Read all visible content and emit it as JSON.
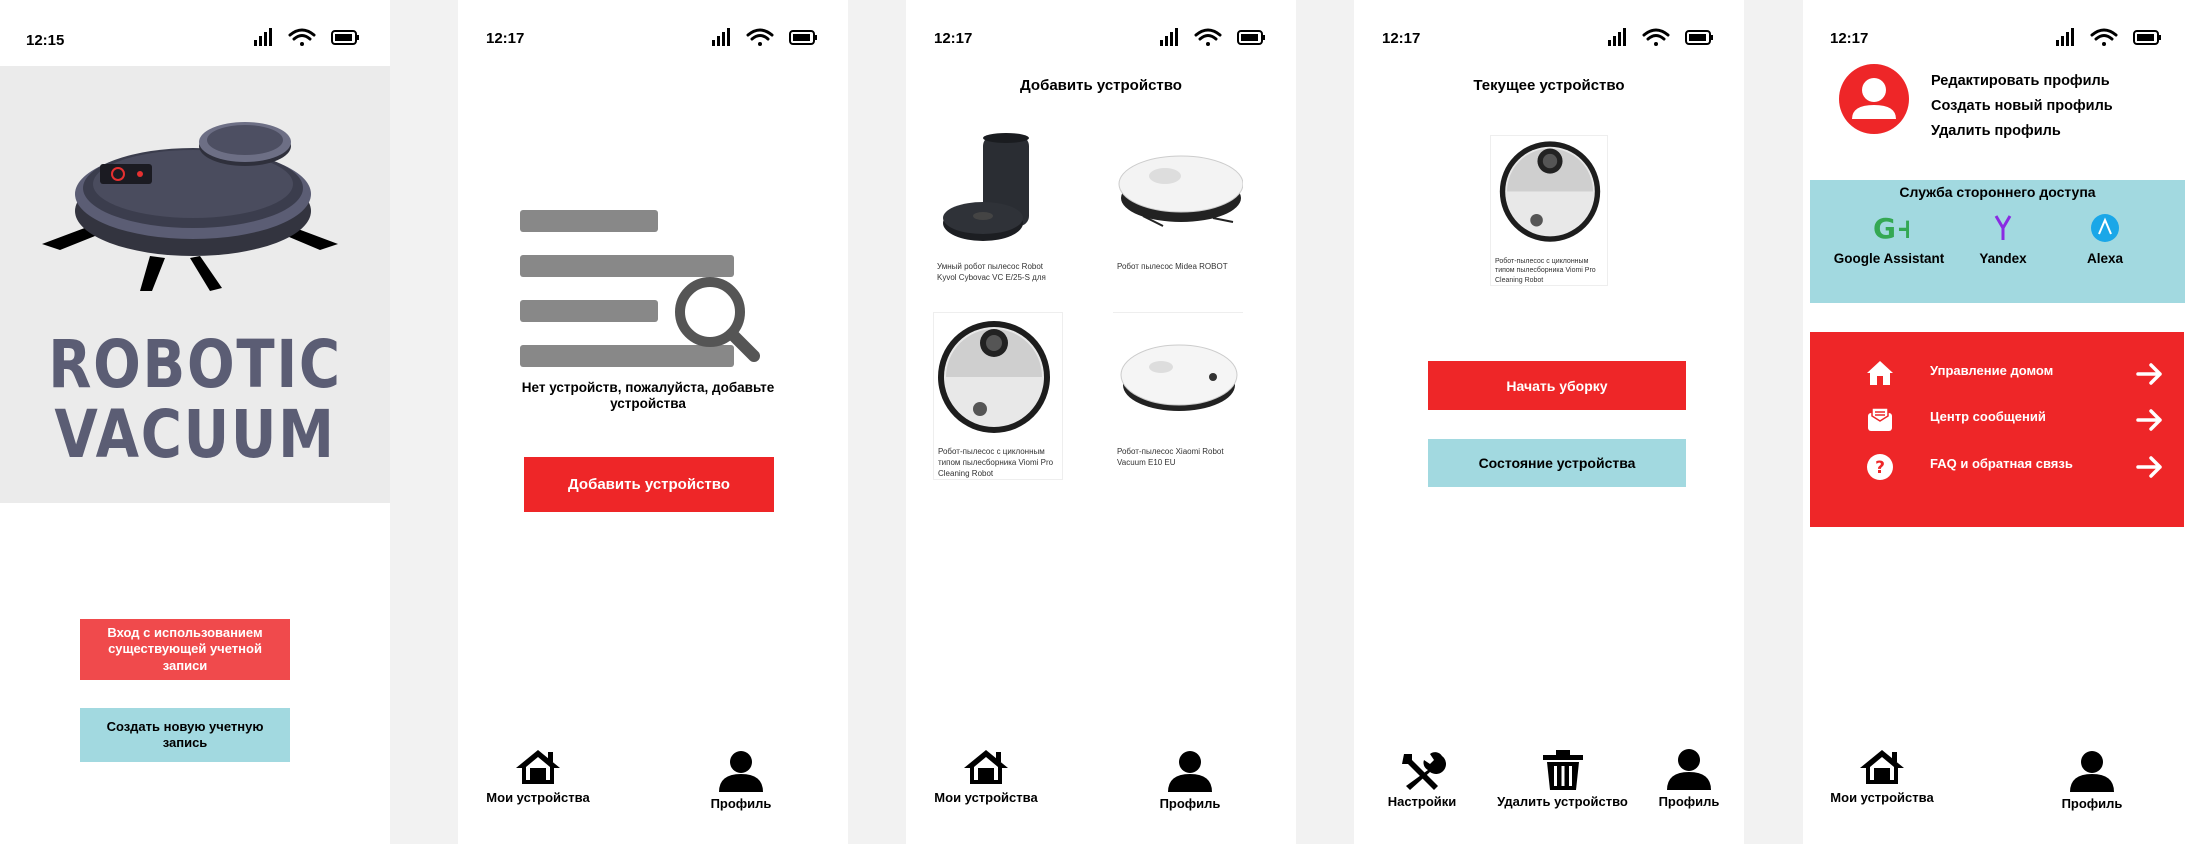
{
  "colors": {
    "accent_red": "#ee2628",
    "accent_blue": "#a2d9e0",
    "login_red": "#f04a4c",
    "logo_gray": "#5b5d74"
  },
  "screen1": {
    "time": "12:15",
    "logo_line1": "ROBOTIC",
    "logo_line2": "VACUUM",
    "login_button": "Вход с использованием существующей учетной записи",
    "create_button": "Создать новую учетную запись"
  },
  "screen2": {
    "time": "12:17",
    "empty_text": "Нет устройств, пожалуйста, добавьте устройства",
    "add_button": "Добавить устройство",
    "nav": {
      "devices": "Мои устройства",
      "profile": "Профиль"
    }
  },
  "screen3": {
    "time": "12:17",
    "title": "Добавить устройство",
    "devices": [
      {
        "caption": "Умный робот пылесос Robot Kyvol Cybovac VC E/25-S для",
        "icon": "robot-vacuum-dock-black"
      },
      {
        "caption": "Робот пылесос Midea ROBOT",
        "icon": "robot-vacuum-white"
      },
      {
        "caption": "Робот-пылесос с циклонным типом пылесборника Viomi Pro Cleaning Robot",
        "icon": "robot-vacuum-viomi"
      },
      {
        "caption": "Робот-пылесос Xiaomi Robot Vacuum E10 EU",
        "icon": "robot-vacuum-xiaomi"
      }
    ],
    "nav": {
      "devices": "Мои устройства",
      "profile": "Профиль"
    }
  },
  "screen4": {
    "time": "12:17",
    "title": "Текущее устройство",
    "device_caption": "Робот-пылесос с циклонным типом пылесборника Viomi Pro Cleaning Robot",
    "start_button": "Начать уборку",
    "status_button": "Состояние устройства",
    "nav": {
      "settings": "Настройки",
      "delete": "Удалить устройство",
      "profile": "Профиль"
    }
  },
  "screen5": {
    "time": "12:17",
    "menu": [
      "Редактировать профиль",
      "Создать новый профиль",
      "Удалить профиль"
    ],
    "access_title": "Служба стороннего доступа",
    "services": [
      {
        "name": "Google Assistant",
        "icon": "google-plus-icon",
        "color": "#34a853"
      },
      {
        "name": "Yandex",
        "icon": "yandex-icon",
        "color": "#8a2be2"
      },
      {
        "name": "Alexa",
        "icon": "alexa-icon",
        "color": "#1aa7e8"
      }
    ],
    "links": [
      {
        "label": "Управление домом",
        "icon": "home-icon"
      },
      {
        "label": "Центр сообщений",
        "icon": "message-icon"
      },
      {
        "label": "FAQ и обратная связь",
        "icon": "help-icon"
      }
    ],
    "nav": {
      "devices": "Мои устройства",
      "profile": "Профиль"
    }
  }
}
